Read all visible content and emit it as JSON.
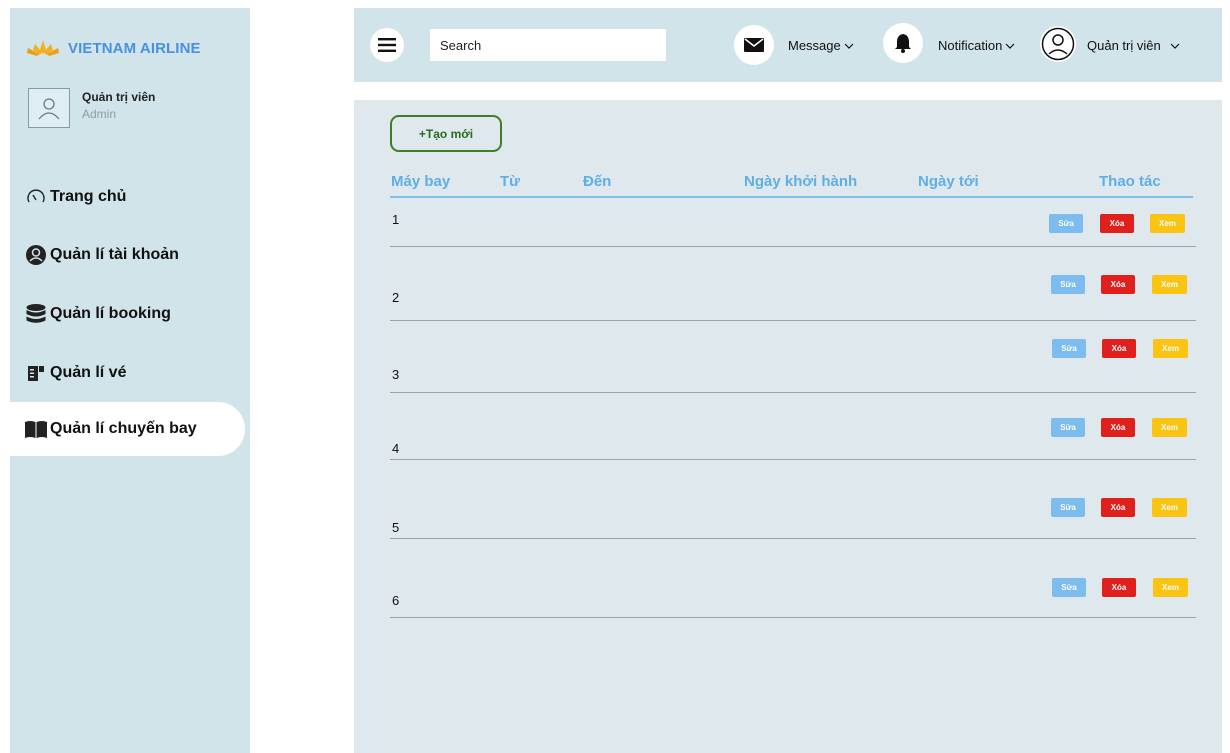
{
  "sidebar": {
    "brand": "VIETNAM AIRLINE",
    "profile": {
      "name": "Quản trị viên",
      "role": "Admin"
    },
    "items": [
      {
        "label": "Trang chủ",
        "icon": "dashboard-icon"
      },
      {
        "label": "Quản lí tài khoản",
        "icon": "user-circle-icon"
      },
      {
        "label": "Quản lí booking",
        "icon": "database-icon"
      },
      {
        "label": "Quản lí vé",
        "icon": "ticket-icon"
      },
      {
        "label": "Quản lí chuyến bay",
        "icon": "book-icon",
        "active": true
      }
    ]
  },
  "topbar": {
    "search_placeholder": "Search",
    "message_label": "Message",
    "notification_label": "Notification",
    "user_label": "Quản trị viên"
  },
  "toolbar": {
    "create_label": "+Tạo mới"
  },
  "table": {
    "headers": [
      "Máy bay",
      "Từ",
      "Đến",
      "Ngày khởi hành",
      "Ngày tới",
      "Thao tác"
    ],
    "rows": [
      {
        "id": "1"
      },
      {
        "id": "2"
      },
      {
        "id": "3"
      },
      {
        "id": "4"
      },
      {
        "id": "5"
      },
      {
        "id": "6"
      }
    ],
    "actions": {
      "edit": "Sửa",
      "delete": "Xóa",
      "view": "Xem"
    }
  },
  "colors": {
    "sidebar_bg": "#d0e4ea",
    "main_bg": "#dfe8ec",
    "brand": "#4a90e2",
    "header_text": "#5eaee8",
    "edit": "#7cbcee",
    "delete": "#e0201c",
    "view": "#fbc312",
    "create_border": "#3f7d2a"
  }
}
